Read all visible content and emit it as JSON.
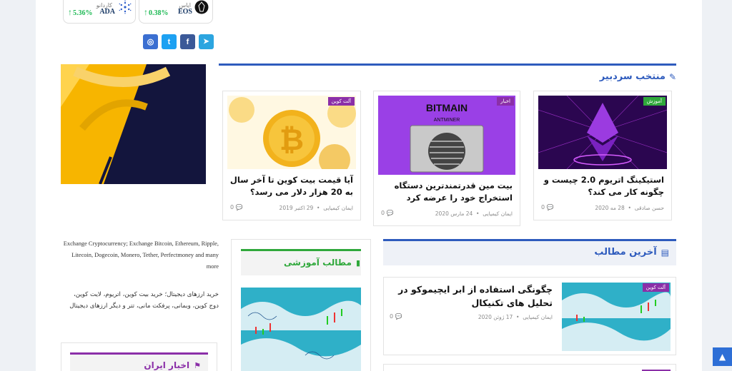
{
  "ticker": [
    {
      "name": "کاردانو",
      "symbol": "ADA",
      "change": "5.36%"
    },
    {
      "name": "ایاس",
      "symbol": "EOS",
      "change": "0.38%"
    }
  ],
  "social": [
    {
      "icon": "instagram-icon",
      "glyph": "◎"
    },
    {
      "icon": "twitter-icon",
      "glyph": "t"
    },
    {
      "icon": "facebook-icon",
      "glyph": "f"
    },
    {
      "icon": "telegram-icon",
      "glyph": "➤"
    }
  ],
  "editors_pick": {
    "title": "منتخب سردبیر",
    "cards": [
      {
        "badge": "آموزش",
        "title": "استیکینگ اتریوم 2.0 چیست و چگونه کار می کند؟",
        "author": "حسن صادقی",
        "date": "28 مه 2020",
        "comments": "0"
      },
      {
        "badge": "اخبار",
        "title": "بیت مین قدرتمندترین دستگاه استخراج خود را عرضه کرد",
        "author": "ایمان کیمیایی",
        "date": "24 مارس 2020",
        "comments": "0"
      },
      {
        "badge": "آلت کوین",
        "title": "آیا قیمت بیت کوین تا آخر سال به 20 هزار دلار می رسد؟",
        "author": "ایمان کیمیایی",
        "date": "29 اکتبر 2019",
        "comments": "0"
      }
    ]
  },
  "images": {
    "bitmain_logo": "BITMAIN",
    "antminer": "ANTMINER"
  },
  "latest": {
    "title": "آخرین مطالب",
    "card": {
      "badge": "آلت کوین",
      "title": "چگونگی استفاده از ابر ایچیموکو در تحلیل های تکنیکال",
      "author": "ایمان کیمیایی",
      "date": "17 ژوئن 2020",
      "comments": "0"
    }
  },
  "educational": {
    "title": "مطالب آموزشی"
  },
  "iran_news": {
    "title": "اخبار ایران"
  },
  "sidebar_text": {
    "en": "Exchange Cryptocurrency; Exchange Bitcoin, Ethereum, Ripple, Litecoin, Dogecoin, Monero, Tether, Perfectmoney and many more",
    "fa": "خرید ارزهای دیجیتال؛ خرید بیت کوین، اتریوم، لایت کوین، دوج کوین، وبمانی، پرفکت مانی، تتر و دیگر ارزهای دیجیتال"
  },
  "colors": {
    "accent": "#2e5bbd",
    "badge": "#8b2fa8",
    "green": "#1db954",
    "scroll_top": "#2e6fd6",
    "purple_line": "#8b2fa8"
  }
}
